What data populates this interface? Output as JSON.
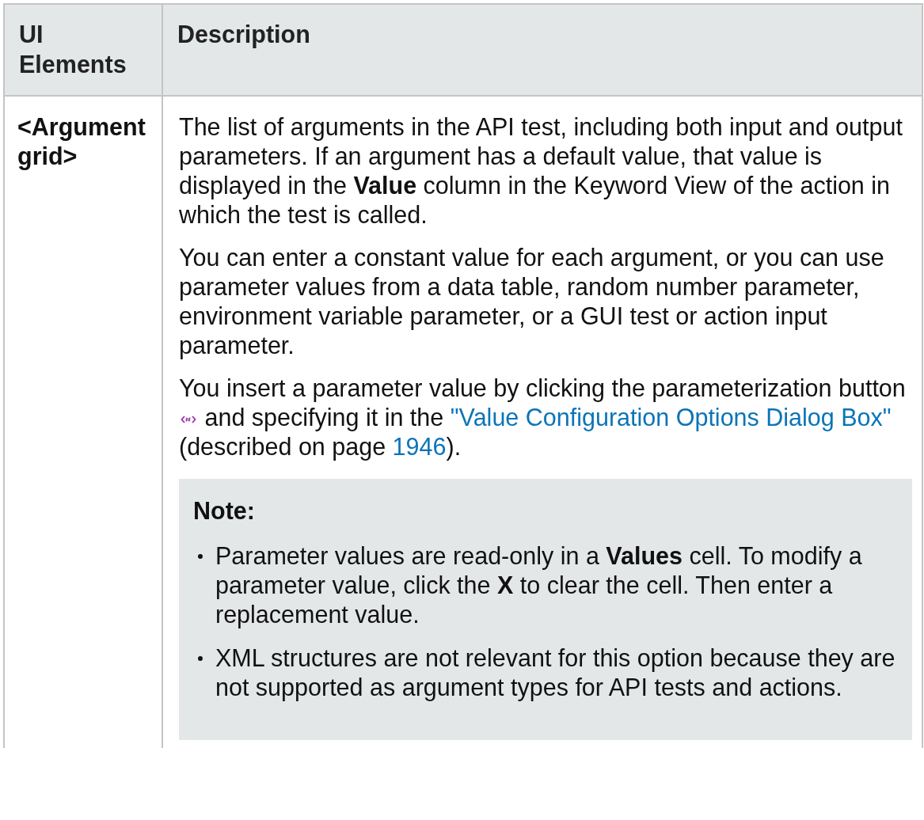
{
  "table": {
    "columns": [
      "UI Elements",
      "Description"
    ],
    "rows": [
      {
        "element": "<Argument grid>",
        "paragraphs": [
          [
            {
              "kind": "text",
              "text": "The list of arguments in the API test, including both input and output parameters. If an argument has a default value, that value is displayed in the **Value** column in the Keyword View of the action in which the test is called."
            }
          ],
          [
            {
              "kind": "text",
              "text": "You can enter a constant value for each argument, or you can use parameter values from a data table, random number parameter, environment variable parameter, or a GUI test or action input parameter."
            }
          ],
          [
            {
              "kind": "text",
              "text": "You insert a parameter value by clicking the parameterization button "
            },
            {
              "kind": "icon"
            },
            {
              "kind": "text",
              "text": " and specifying it in the "
            },
            {
              "kind": "link",
              "text": "\"Value Configuration Options Dialog Box\""
            },
            {
              "kind": "text",
              "text": " (described on page "
            },
            {
              "kind": "link",
              "text": "1946"
            },
            {
              "kind": "text",
              "text": ")."
            }
          ]
        ],
        "note": {
          "title": "Note:",
          "items": [
            "Parameter values are read-only in a **Values** cell. To modify a parameter value, click the **X** to clear the cell. Then enter a replacement value.",
            "XML structures are not relevant for this option because they are not supported as argument types for API tests and actions."
          ]
        }
      }
    ]
  }
}
